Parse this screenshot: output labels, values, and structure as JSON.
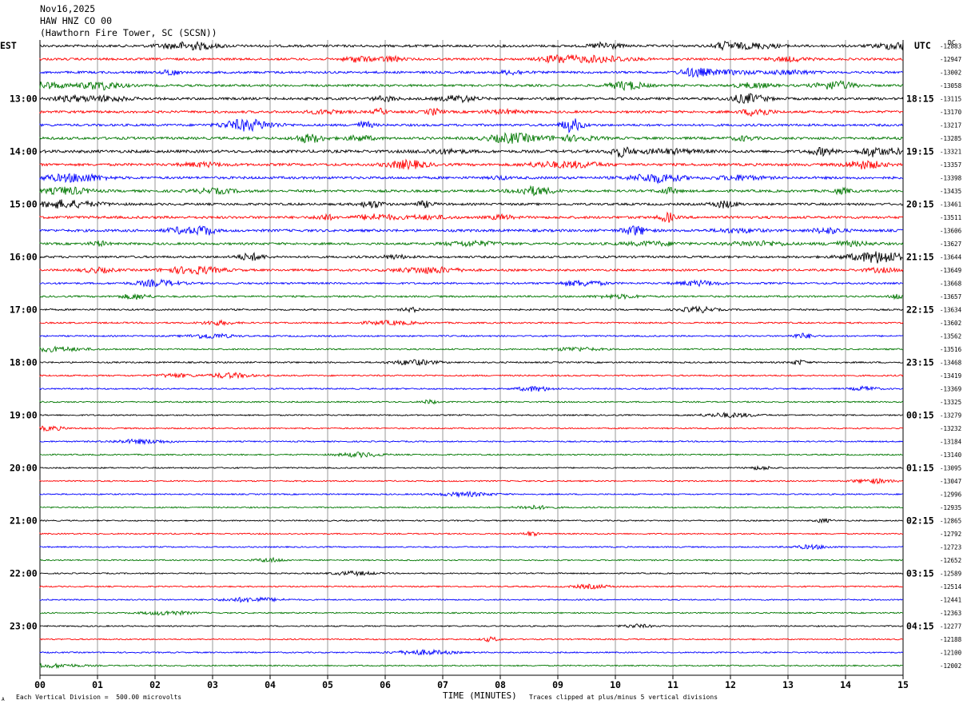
{
  "header": {
    "date": "Nov16,2025",
    "channel": "HAW HNZ CO 00",
    "station": "(Hawthorn Fire Tower, SC (SCSN))"
  },
  "left_axis_label": "EST",
  "right_axis_label": "UTC",
  "dc_label": "DC",
  "footer": {
    "scale_note": "Each Vertical Division =  500.00 microvolts",
    "clip_note": "Traces clipped at plus/minus 5 vertical divisions",
    "corner_mark": "A"
  },
  "chart_data": {
    "type": "line",
    "title": "",
    "xlabel": "TIME (MINUTES)",
    "xlim": [
      0,
      15
    ],
    "x_ticks": [
      "00",
      "01",
      "02",
      "03",
      "04",
      "05",
      "06",
      "07",
      "08",
      "09",
      "10",
      "11",
      "12",
      "13",
      "14",
      "15"
    ],
    "trace_colors": [
      "#000000",
      "#ff0000",
      "#0000ff",
      "#007700"
    ],
    "grid_color_vertical": "#808080",
    "est_hour_labels": [
      "13:00",
      "14:00",
      "15:00",
      "16:00",
      "17:00",
      "18:00",
      "19:00",
      "20:00",
      "21:00",
      "22:00",
      "23:00"
    ],
    "utc_labels": [
      "18:15",
      "19:15",
      "20:15",
      "21:15",
      "22:15",
      "23:15",
      "00:15",
      "01:15",
      "02:15",
      "03:15",
      "04:15"
    ],
    "dc_offsets": [
      "-12883",
      "-12947",
      "-13002",
      "-13058",
      "-13115",
      "-13170",
      "-13217",
      "-13285",
      "-13321",
      "-13357",
      "-13398",
      "-13435",
      "-13461",
      "-13511",
      "-13606",
      "-13627",
      "-13644",
      "-13649",
      "-13668",
      "-13657",
      "-13634",
      "-13602",
      "-13562",
      "-13516",
      "-13468",
      "-13419",
      "-13369",
      "-13325",
      "-13279",
      "-13232",
      "-13184",
      "-13140",
      "-13095",
      "-13047",
      "-12996",
      "-12935",
      "-12865",
      "-12792",
      "-12723",
      "-12652",
      "-12589",
      "-12514",
      "-12441",
      "-12363",
      "-12277",
      "-12188",
      "-12100",
      "-12002"
    ],
    "trace_activity": [
      0.55,
      0.5,
      0.5,
      0.5,
      0.6,
      0.55,
      0.5,
      0.6,
      0.7,
      0.6,
      0.6,
      0.55,
      0.5,
      0.6,
      0.6,
      0.5,
      0.45,
      0.45,
      0.35,
      0.3,
      0.25,
      0.22,
      0.2,
      0.2,
      0.22,
      0.2,
      0.18,
      0.16,
      0.15,
      0.15,
      0.14,
      0.14,
      0.14,
      0.14,
      0.14,
      0.14,
      0.13,
      0.13,
      0.13,
      0.13,
      0.13,
      0.13,
      0.13,
      0.13,
      0.13,
      0.13,
      0.13,
      0.13
    ]
  }
}
